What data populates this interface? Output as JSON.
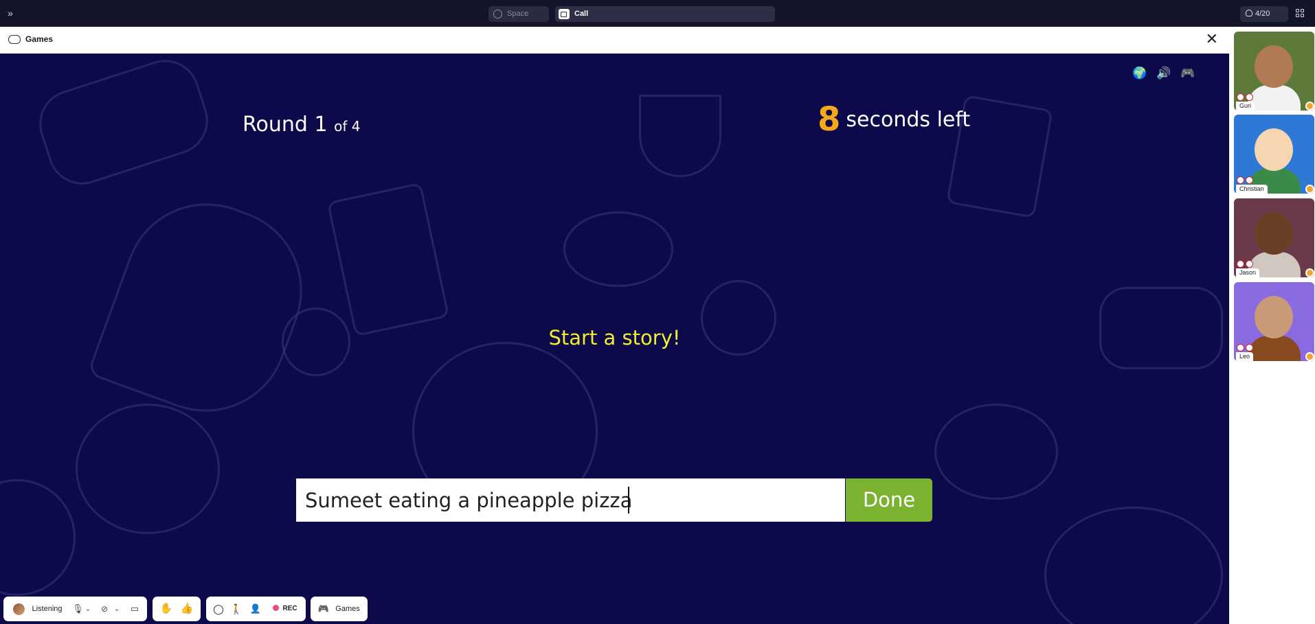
{
  "topbar": {
    "space_tab": "Space",
    "call_tab": "Call",
    "participants": "4/20"
  },
  "games_panel": {
    "title": "Games",
    "close": "✕"
  },
  "game": {
    "round_label": "Round 1",
    "round_of": "of 4",
    "seconds": "8",
    "seconds_label": "seconds left",
    "prompt": "Start a story!",
    "input_value": "Sumeet eating a pineapple pizza",
    "done_label": "Done",
    "icons": [
      "globe-icon",
      "sound-icon",
      "gamepad-icon"
    ]
  },
  "toolbar": {
    "status_label": "Listening",
    "rec_label": "REC",
    "games_label": "Games"
  },
  "participants": [
    {
      "name": "Guri",
      "bg": "#5d7a3a",
      "skin": "#b07a55",
      "shirt": "#f2f2f2"
    },
    {
      "name": "Christian",
      "bg": "#2f79d6",
      "skin": "#f6d6b0",
      "shirt": "#3a8a4a"
    },
    {
      "name": "Jason",
      "bg": "#6a3a4a",
      "skin": "#6b3f25",
      "shirt": "#d0c8c0"
    },
    {
      "name": "Leo",
      "bg": "#8a6ae0",
      "skin": "#c89a78",
      "shirt": "#8a4a20"
    }
  ],
  "colors": {
    "game_bg": "#0c0a4a",
    "timer_accent": "#f6a81c",
    "prompt": "#f4ec32",
    "done_button": "#7bb22f",
    "rec_dot": "#e84a86",
    "status_dot": "#f0a52a"
  }
}
